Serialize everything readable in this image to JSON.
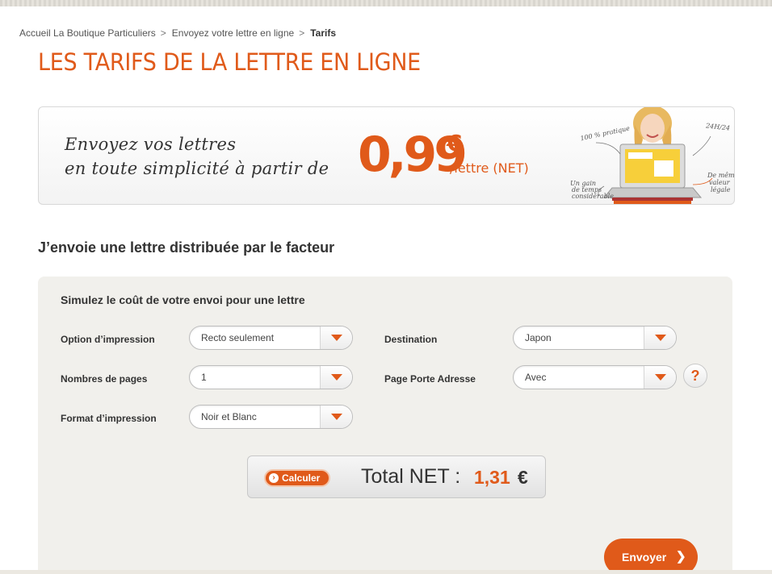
{
  "breadcrumb": {
    "items": [
      "Accueil La Boutique Particuliers",
      "Envoyez votre lettre en ligne"
    ],
    "current": "Tarifs",
    "separator": ">"
  },
  "page": {
    "title": "LES TARIFS DE LA LETTRE EN LIGNE",
    "subheading": "J’envoie une lettre distribuée par le facteur"
  },
  "banner": {
    "line1": "Envoyez vos lettres",
    "line2": "en toute simplicité à partir de",
    "price": "0,99",
    "currency": "€",
    "unit": "/lettre (NET)",
    "notes": {
      "pratique": "100 % pratique",
      "hours": "24H/24",
      "gain_1": "Un gain",
      "gain_2": "de temps",
      "gain_3": "considérable",
      "valeur_1": "De même",
      "valeur_2": "valeur",
      "valeur_3": "légale"
    }
  },
  "simulator": {
    "title": "Simulez le coût de votre envoi pour une lettre",
    "fields": {
      "impression": {
        "label": "Option d’impression",
        "value": "Recto seulement"
      },
      "pages": {
        "label": "Nombres de pages",
        "value": "1"
      },
      "format": {
        "label": "Format d’impression",
        "value": "Noir et Blanc"
      },
      "destination": {
        "label": "Destination",
        "value": "Japon"
      },
      "porte_adresse": {
        "label": "Page Porte Adresse",
        "value": "Avec"
      }
    },
    "help": "?",
    "calc_button": "Calculer",
    "total_label": "Total NET :",
    "total_value": "1,31",
    "total_currency": "€",
    "send_button": "Envoyer"
  },
  "colors": {
    "accent": "#e05a1a",
    "panel": "#f1f0ec"
  }
}
